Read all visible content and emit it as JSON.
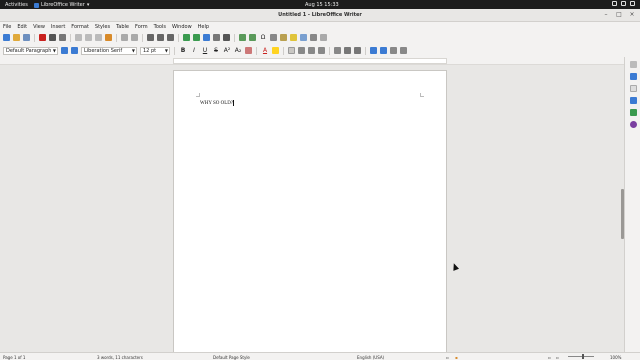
{
  "topbar": {
    "activities": "Activities",
    "app_name": "LibreOffice Writer",
    "clock": "Aug 15  15:33"
  },
  "window": {
    "title": "Untitled 1 - LibreOffice Writer"
  },
  "menu": [
    "File",
    "Edit",
    "View",
    "Insert",
    "Format",
    "Styles",
    "Table",
    "Form",
    "Tools",
    "Window",
    "Help"
  ],
  "formatting": {
    "paragraph_style": "Default Paragraph",
    "font_name": "Liberation Serif",
    "font_size": "12 pt"
  },
  "document": {
    "text": "WHY SO OLD?"
  },
  "status": {
    "page": "Page 1 of 1",
    "words": "3 words, 11 characters",
    "page_style": "Default Page Style",
    "language": "English (USA)",
    "zoom": "100%"
  },
  "colors": {
    "accent": "#3b7bd3",
    "font_color": "#c9211e",
    "highlight": "#ffd320"
  }
}
